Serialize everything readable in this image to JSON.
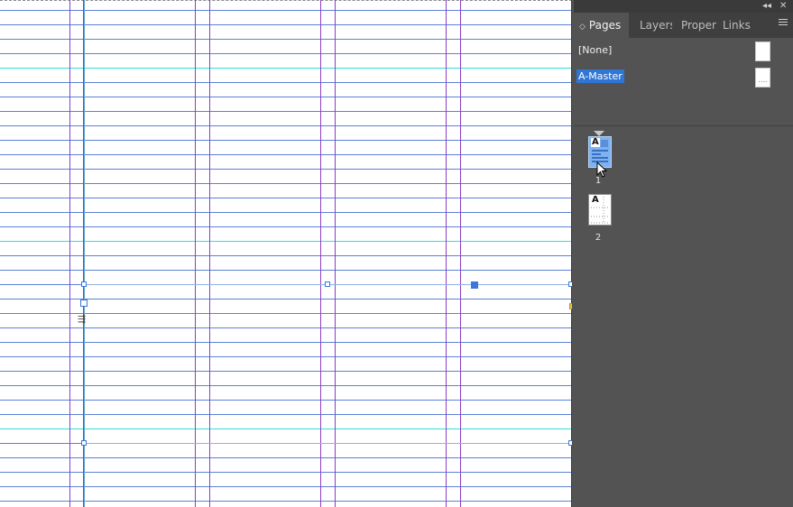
{
  "panel": {
    "tabs": [
      {
        "label": "Pages",
        "active": true
      },
      {
        "label": "Layers",
        "active": false
      },
      {
        "label": "Proper",
        "active": false
      },
      {
        "label": "Links",
        "active": false
      }
    ],
    "collapse_glyph": "◂◂",
    "close_glyph": "✕",
    "masters": [
      {
        "label": "[None]",
        "selected": false
      },
      {
        "label": "A-Master",
        "selected": true
      }
    ],
    "master_dots": "....",
    "pages": [
      {
        "number": "1",
        "master_prefix": "A",
        "selected": true
      },
      {
        "number": "2",
        "master_prefix": "A",
        "selected": false
      }
    ]
  },
  "colors": {
    "guide_column": "#8b3ec8",
    "guide_baseline": "#5b82d6",
    "guide_baseline_major": "#2ee0e0",
    "selection": "#3a78e0",
    "panel_bg": "#535353"
  },
  "icons": {
    "thread_cursor": "⇶"
  }
}
